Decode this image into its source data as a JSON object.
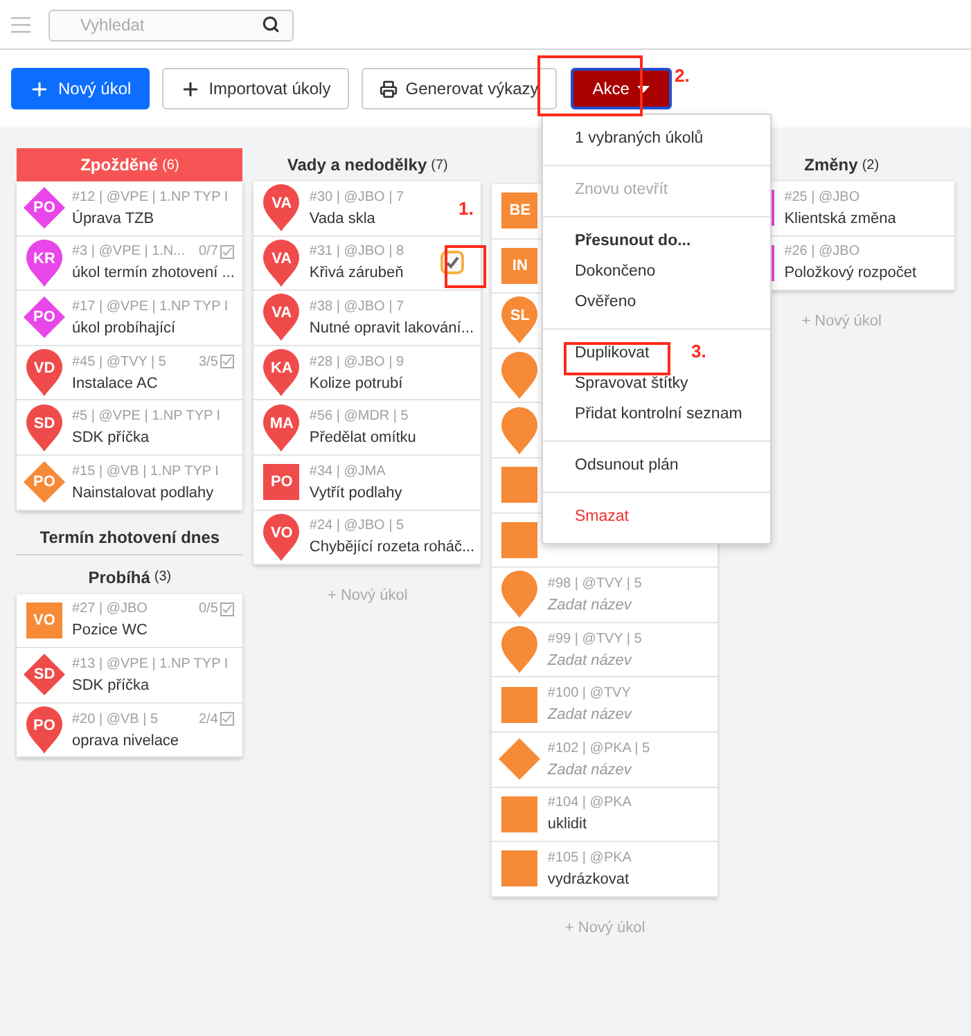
{
  "top_bar": {
    "search": {
      "placeholder": "Vyhledat"
    }
  },
  "toolbar": {
    "buttons": [
      {
        "label": "Nový úkol",
        "kind": "primary"
      },
      {
        "label": "Importovat úkoly",
        "kind": "import"
      },
      {
        "label": "Generovat výkazy",
        "kind": "print"
      },
      {
        "label": "Akce",
        "kind": "menu"
      }
    ]
  },
  "columns": [
    {
      "sections": [
        {
          "title": "Zpožděné",
          "count": "(6)",
          "alert": true,
          "cards": [
            {
              "marker": {
                "kind": "diamond",
                "color": "#e846e8",
                "label": "PO"
              },
              "meta": "#12 | @VPE | 1.NP TYP I",
              "title": "Úprava TZB",
              "selected": false
            },
            {
              "marker": {
                "kind": "pin",
                "color": "#e846e8",
                "label": "KR"
              },
              "meta": "#3 | @VPE | 1.N...",
              "checklist": "0/7",
              "title": "úkol termín zhotovení ...",
              "selected": false
            },
            {
              "marker": {
                "kind": "diamond",
                "color": "#e846e8",
                "label": "PO"
              },
              "meta": "#17 | @VPE | 1.NP TYP I",
              "title": "úkol probíhající",
              "selected": false
            },
            {
              "marker": {
                "kind": "pin",
                "color": "#f04b4b",
                "label": "VD"
              },
              "meta": "#45 | @TVY | 5",
              "checklist": "3/5",
              "title": "Instalace AC",
              "selected": false
            },
            {
              "marker": {
                "kind": "pin",
                "color": "#f04b4b",
                "label": "SD"
              },
              "meta": "#5 | @VPE | 1.NP TYP I",
              "title": "SDK příčka",
              "selected": false
            },
            {
              "marker": {
                "kind": "diamond",
                "color": "#f68a37",
                "label": "PO"
              },
              "meta": "#15 | @VB | 1.NP TYP I",
              "title": "Nainstalovat podlahy",
              "selected": false
            }
          ]
        },
        {
          "title": "Termín zhotovení dnes"
        },
        {
          "title": "Probíhá",
          "count": "(3)",
          "cards": [
            {
              "marker": {
                "kind": "square",
                "color": "#f68a37",
                "label": "VO"
              },
              "meta": "#27 | @JBO",
              "checklist": "0/5",
              "title": "Pozice WC",
              "selected": false
            },
            {
              "marker": {
                "kind": "diamond",
                "color": "#f04b4b",
                "label": "SD"
              },
              "meta": "#13 | @VPE | 1.NP TYP I",
              "title": "SDK příčka",
              "selected": false
            },
            {
              "marker": {
                "kind": "pin",
                "color": "#f04b4b",
                "label": "PO"
              },
              "meta": "#20 | @VB | 5",
              "checklist": "2/4",
              "title": "oprava nivelace",
              "selected": false
            }
          ]
        }
      ]
    },
    {
      "sections": [
        {
          "title": "Vady a nedodělky",
          "count": "(7)",
          "cards": [
            {
              "marker": {
                "kind": "pin",
                "color": "#f04b4b",
                "label": "VA"
              },
              "meta": "#30 | @JBO | 7",
              "title": "Vada skla",
              "selected": false
            },
            {
              "marker": {
                "kind": "pin",
                "color": "#f04b4b",
                "label": "VA"
              },
              "meta": "#31 | @JBO | 8",
              "title": "Křivá zárubeň",
              "selected": true
            },
            {
              "marker": {
                "kind": "pin",
                "color": "#f04b4b",
                "label": "VA"
              },
              "meta": "#38 | @JBO | 7",
              "title": "Nutné opravit lakování...",
              "selected": false
            },
            {
              "marker": {
                "kind": "pin",
                "color": "#f04b4b",
                "label": "KA"
              },
              "meta": "#28 | @JBO | 9",
              "title": "Kolize potrubí",
              "selected": false
            },
            {
              "marker": {
                "kind": "pin",
                "color": "#f04b4b",
                "label": "MA"
              },
              "meta": "#56 | @MDR | 5",
              "title": "Předělat omítku",
              "selected": false
            },
            {
              "marker": {
                "kind": "square",
                "color": "#f04b4b",
                "label": "PO"
              },
              "meta": "#34 | @JMA",
              "title": "Vytřít podlahy",
              "selected": false
            },
            {
              "marker": {
                "kind": "pin",
                "color": "#f04b4b",
                "label": "VO"
              },
              "meta": "#24 | @JBO | 5",
              "title": "Chybějící rozeta roháč...",
              "selected": false
            }
          ]
        }
      ],
      "add_label": "+ Nový úkol"
    },
    {
      "sections": [
        {
          "cards": [
            {
              "marker": {
                "kind": "square",
                "color": "#f68a37",
                "label": "BE"
              }
            },
            {
              "marker": {
                "kind": "square",
                "color": "#f68a37",
                "label": "IN"
              }
            },
            {
              "marker": {
                "kind": "pin",
                "color": "#f68a37",
                "label": "SL"
              }
            },
            {
              "marker": {
                "kind": "pin",
                "color": "#f68a37"
              }
            },
            {
              "marker": {
                "kind": "pin",
                "color": "#f68a37"
              }
            },
            {
              "marker": {
                "kind": "square",
                "color": "#f68a37"
              }
            },
            {
              "marker": {
                "kind": "square",
                "color": "#f68a37"
              }
            },
            {
              "marker": {
                "kind": "pin",
                "color": "#f68a37"
              },
              "meta": "#98 | @TVY | 5",
              "title": "Zadat název",
              "placeholder": true,
              "selected": false
            },
            {
              "marker": {
                "kind": "pin",
                "color": "#f68a37"
              },
              "meta": "#99 | @TVY | 5",
              "title": "Zadat název",
              "placeholder": true,
              "selected": false
            },
            {
              "marker": {
                "kind": "square",
                "color": "#f68a37"
              },
              "meta": "#100 | @TVY",
              "title": "Zadat název",
              "placeholder": true,
              "selected": false
            },
            {
              "marker": {
                "kind": "diamond",
                "color": "#f68a37"
              },
              "meta": "#102 | @PKA | 5",
              "title": "Zadat název",
              "placeholder": true,
              "selected": false
            },
            {
              "marker": {
                "kind": "square",
                "color": "#f68a37"
              },
              "meta": "#104 | @PKA",
              "title": "uklidit",
              "selected": false
            },
            {
              "marker": {
                "kind": "square",
                "color": "#f68a37"
              },
              "meta": "#105 | @PKA",
              "title": "vydrázkovat",
              "selected": false
            }
          ]
        }
      ],
      "add_label": "+ Nový úkol"
    },
    {
      "sections": [
        {
          "title": "Změny",
          "count": "(2)",
          "cards": [
            {
              "marker": {
                "kind": "square",
                "color": "#e846e8"
              },
              "meta": "#25 | @JBO",
              "title": "Klientská změna",
              "selected": false
            },
            {
              "marker": {
                "kind": "square",
                "color": "#e846e8"
              },
              "meta": "#26 | @JBO",
              "title": "Položkový rozpočet",
              "selected": false
            }
          ]
        }
      ],
      "add_label": "+ Nový úkol"
    }
  ],
  "action_menu": {
    "groups": [
      [
        {
          "label": "1 vybraných úkolů",
          "kind": "info"
        }
      ],
      [
        {
          "label": "Znovu otevřít",
          "kind": "disabled"
        }
      ],
      [
        {
          "label": "Přesunout do...",
          "kind": "heading"
        },
        {
          "label": "Dokončeno",
          "kind": "item"
        },
        {
          "label": "Ověřeno",
          "kind": "item"
        }
      ],
      [
        {
          "label": "Duplikovat",
          "kind": "item"
        },
        {
          "label": "Spravovat štítky",
          "kind": "item"
        },
        {
          "label": "Přidat kontrolní seznam",
          "kind": "item"
        }
      ],
      [
        {
          "label": "Odsunout plán",
          "kind": "item"
        }
      ],
      [
        {
          "label": "Smazat",
          "kind": "danger"
        }
      ]
    ]
  },
  "annotations": [
    {
      "label": "1."
    },
    {
      "label": "2."
    },
    {
      "label": "3."
    }
  ]
}
